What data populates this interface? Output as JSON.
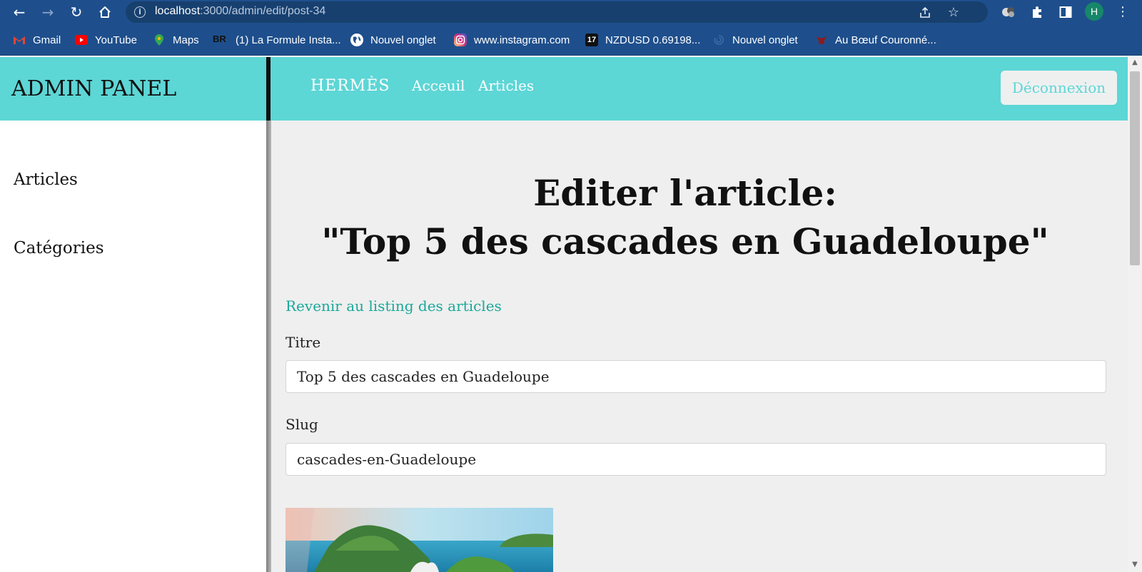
{
  "browser": {
    "url_host": "localhost",
    "url_path": ":3000/admin/edit/post-34",
    "profile_initial": "H",
    "bookmarks": [
      {
        "label": "Gmail",
        "icon": "gmail-icon",
        "color": "#ea4335"
      },
      {
        "label": "YouTube",
        "icon": "youtube-icon",
        "color": "#ff0000"
      },
      {
        "label": "Maps",
        "icon": "maps-icon",
        "color": "#34a853"
      },
      {
        "label": "(1) La Formule Insta...",
        "icon": "br-icon",
        "color": "#111111"
      },
      {
        "label": "Nouvel onglet",
        "icon": "globe-icon",
        "color": "#ffffff"
      },
      {
        "label": "www.instagram.com",
        "icon": "instagram-icon",
        "color": "#d62976"
      },
      {
        "label": "NZDUSD 0.69198...",
        "icon": "tradingview-icon",
        "color": "#111111"
      },
      {
        "label": "Nouvel onglet",
        "icon": "swirl-icon",
        "color": "#3b6aa8"
      },
      {
        "label": "Au Bœuf Couronné...",
        "icon": "bull-icon",
        "color": "#8b1c1c"
      }
    ]
  },
  "app": {
    "admin_title": "ADMIN PANEL",
    "brand": "HERMÈS",
    "nav": [
      "Acceuil",
      "Articles"
    ],
    "logout_label": "Déconnexion",
    "accent_color": "#5dd6d6",
    "link_color": "#1aa89a"
  },
  "sidebar": {
    "items": [
      "Articles",
      "Catégories"
    ]
  },
  "main": {
    "title_line1": "Editer l'article:",
    "title_line2": "\"Top 5 des cascades en Guadeloupe\"",
    "back_link": "Revenir au listing des articles",
    "fields": [
      {
        "label": "Titre",
        "value": "Top 5 des cascades en Guadeloupe"
      },
      {
        "label": "Slug",
        "value": "cascades-en-Guadeloupe"
      }
    ]
  }
}
